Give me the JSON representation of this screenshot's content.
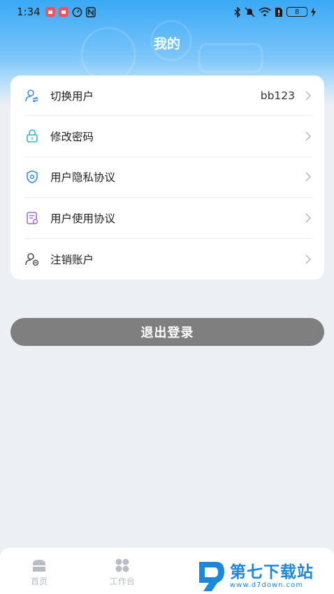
{
  "status_bar": {
    "time": "1:34",
    "battery": "8"
  },
  "header": {
    "title": "我的"
  },
  "menu": {
    "items": [
      {
        "label": "切换用户",
        "value": "bb123",
        "icon": "switch-user-icon"
      },
      {
        "label": "修改密码",
        "value": "",
        "icon": "lock-icon"
      },
      {
        "label": "用户隐私协议",
        "value": "",
        "icon": "shield-icon"
      },
      {
        "label": "用户使用协议",
        "value": "",
        "icon": "document-icon"
      },
      {
        "label": "注销账户",
        "value": "",
        "icon": "user-remove-icon"
      }
    ]
  },
  "logout": {
    "label": "退出登录"
  },
  "tab_bar": {
    "tabs": [
      {
        "label": "首页",
        "icon": "home-icon"
      },
      {
        "label": "工作台",
        "icon": "grid-icon"
      }
    ]
  },
  "watermark": {
    "name": "第七下载站",
    "url": "www.d7down.com"
  },
  "colors": {
    "header_blue": "#3aa8f5",
    "logout_gray": "#7f7f7f",
    "watermark_blue": "#1e88d8"
  }
}
